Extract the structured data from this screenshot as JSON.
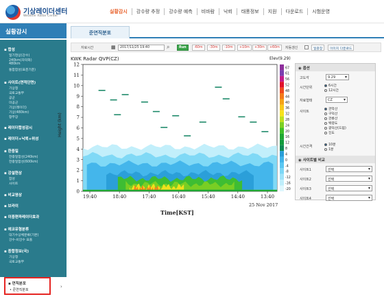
{
  "header": {
    "logo_title": "기상레이더센터",
    "logo_subtitle": "Weather Radar Center",
    "nav": [
      "실황감시",
      "강수량 추정",
      "강수량 예측",
      "비바람",
      "낙뢰",
      "태풍정보",
      "지원",
      "다운로드",
      "시험운영"
    ]
  },
  "sidebar": {
    "title": "실황감시",
    "sections": [
      {
        "label": "합성",
        "items": [
          "일기현상(강수)",
          "240km(자막화)",
          "480km",
          "통합합성(표준기준)"
        ]
      },
      {
        "label": "사이트(면적단면)",
        "items": [
          "기상청",
          "국토교통부",
          "공군",
          "미공군",
          "기상(레이더)",
          "기상(480km)",
          "항무장"
        ]
      },
      {
        "label": "레이더합성감시",
        "items": []
      },
      {
        "label": "레이더+낙뢰+위성",
        "items": []
      },
      {
        "label": "한중일",
        "items": [
          "한중일합성(240km)",
          "한중일합성(600km)"
        ]
      },
      {
        "label": "강설현상",
        "items": [
          "합성",
          "사이트"
        ]
      },
      {
        "label": "비교영상",
        "items": []
      },
      {
        "label": "브라이",
        "items": []
      },
      {
        "label": "이중편파레이더효과",
        "items": []
      },
      {
        "label": "에코유형분류",
        "items": [
          "대기수상체분류(기본)",
          "강수-비강수 표출"
        ]
      },
      {
        "label": "종합정보(국)",
        "items": [
          "기상청",
          "국토교통부"
        ]
      }
    ],
    "selected_section": "연직분포",
    "selected_item": "준연직분포",
    "arrow": "›"
  },
  "tab": {
    "label": "준연직분포"
  },
  "toolbar": {
    "time_label": "자료시간",
    "date_value": "2017/11/25 19:40",
    "buttons": [
      "Run",
      "-60m",
      "-30m",
      "-10m",
      "+10m",
      "+30m",
      "+60m"
    ],
    "auto_label": "자동갱신",
    "btn_large": "일괄창",
    "btn_down": "이미지 다운로드"
  },
  "chart_data": {
    "type": "heatmap",
    "title": "KWK Radar QVP(CZ)",
    "elevation": "Elev(9.29)",
    "ylabel": "Height (km)",
    "xlabel": "Time[KST]",
    "date_label": "25 Nov 2017",
    "y_ticks": [
      0,
      1,
      2,
      3,
      4,
      5,
      6,
      7,
      8,
      9,
      10,
      11,
      12
    ],
    "x_ticks": [
      "19:40",
      "18:40",
      "17:40",
      "16:40",
      "15:40",
      "14:40",
      "13:40"
    ],
    "colorbar_ticks": [
      67,
      61,
      56,
      52,
      48,
      44,
      40,
      36,
      32,
      28,
      24,
      20,
      16,
      12,
      8,
      4,
      0,
      -4,
      -8,
      -12,
      -16,
      -20
    ],
    "colorbar_colors": [
      "#8e2f9c",
      "#7a3fb0",
      "#c21c8a",
      "#e0112b",
      "#f04a1e",
      "#f47a1a",
      "#f5a317",
      "#f8c81a",
      "#f7e21c",
      "#bfe01f",
      "#7ccf24",
      "#3fbf2a",
      "#20a832",
      "#129b3c",
      "#0e8a52",
      "#2a9ed8",
      "#40b4ea",
      "#5ac7f2",
      "#7cd7f6",
      "#9fe3f9",
      "#bfeefb",
      "#def7fd"
    ]
  },
  "options": {
    "header": "옵션",
    "elev_label": "고도각",
    "elev_value": "9.29",
    "time_unit_label": "시간단위",
    "time_unit_options": [
      "6시간",
      "12시간"
    ],
    "data_type_label": "자료형태",
    "data_type_value": "CZ",
    "site_label": "사이트",
    "site_options": [
      "관악산",
      "구덕산",
      "관룡산",
      "백령도",
      "광덕산(드럼)",
      "진도"
    ],
    "interval_label": "시간간격",
    "interval_options": [
      "10분",
      "1분"
    ],
    "site_compare_header": "사이트별 비교",
    "site_rows": [
      "사이트1",
      "사이트2",
      "사이트3",
      "사이트4"
    ],
    "site_select_value": "선택"
  }
}
